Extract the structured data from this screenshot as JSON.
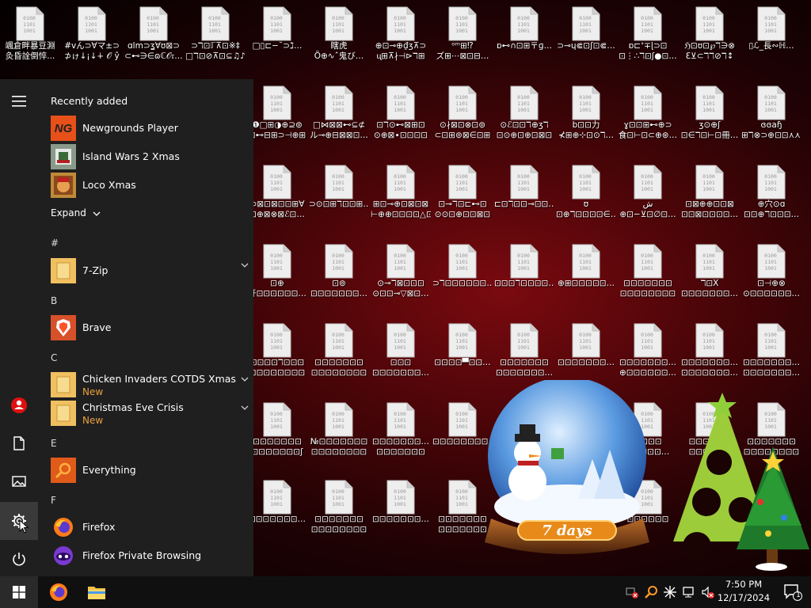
{
  "desktop": {
    "rows": [
      {
        "labels": [
          [
            "颯倉畔暴豆淵",
            "灸昏詮倒悴..."
          ],
          [
            "#vん⊃∀マ±⊃",
            "⊅ゖ↓¡↓∔ 𝒪 ŷ"
          ],
          [
            "ɑlm⊃ʓ∀ʊ⊠⊃",
            "⊂⊷∋∈ɷℂ𝒪𝔯…"
          ],
          [
            "⊃ℸ⊡ℾ⊼⊡※‡",
            "□ℸ⊡⊘⊼⊡⊆♫♪"
          ],
          [
            "□▯⊏−˘⊃ℷ…",
            ""
          ],
          [
            "瞎虎",
            "Ö⊕∿ˆ鬼び…"
          ],
          [
            "⊕⊡⊸⊕₫ʒ⊼⊃",
            "ᶙ⊞⊼∤⊣⊳ℸ⊞"
          ],
          [
            "ᵒᵐ⊞⁉",
            "ズ⊞⋯⊠⊡⊟…"
          ],
          [
            "ɒ⊷∩⊡⊞〒ɡ…",
            ""
          ],
          [
            "⊃⊸ɥ⋐⊡ʃ⊡⋐…",
            ""
          ],
          [
            "ɒ⊏ᐩ∓ɭ⊃⊡",
            "⊡⋮∴ℸ⊡ʃ●⊡…"
          ],
          [
            "ℌ⊡ʊ⊡℘ℸ∋⊗",
            "ℇ⊻⊂ℸℸ⊘ℸ↕"
          ],
          [
            "▯ℒ_長∾ℍ…",
            ""
          ]
        ]
      },
      {
        "labels": [
          [
            "❶□⊞◑⊕⊇⊚",
            "⊡⊷⊟⊞⊃⊣⊕⊞"
          ],
          [
            "□⋈⊠⊠⊷⊆⊄",
            "ル⊸⊕⊟⊠⊠⊡…"
          ],
          [
            "⊡ℸ⊙⊷⊠⊞⊡",
            "⊙⊕⊠∙⊡⊡⊡⊡"
          ],
          [
            "⊙∤⊠⊡⊗⊡⊚",
            "⊂⊡⊞⊚⊠∈⊡⊞"
          ],
          [
            "⊙ℰ⊡⊡ℸ⊕ʒℸ",
            "⊡⊙⊕⊡⊕⊡⊠⊡"
          ],
          [
            "b⊡⊡力",
            "⊀⊞⊕⊹⊡⊙ℸ…"
          ],
          [
            "ɣ⊡⊡⊞⊷⊕⊃",
            "食⊡⊢⊡⊂⊕⊛…"
          ],
          [
            "ʒ⊙⊕ʃ",
            "⊡∈ℸ⊡⊢⊡冊…"
          ],
          [
            "ɞɞaɧ",
            "⊞ℸ⊗⊃⊕⊡⊡⋏⋏…"
          ]
        ]
      },
      {
        "labels": [
          [
            "⊃⊠⊡⊠⊡⊡⊞∀",
            "⊡⊕⊠⊗⊠ℰ⊡…"
          ],
          [
            "⊃⊙⊡⊞ℸ⊡⊡⊞…",
            ""
          ],
          [
            "⊞⊡⊸⊕⊡⊠⊡⊠",
            "⊢⊕⊕⊡⊡⊡⊡△⊡"
          ],
          [
            "⊡⊸ℸ⊡⊏⊷⊡",
            "⊙⊙⊡⊕⊡⊡⊠⊡"
          ],
          [
            "⊏⊡ℸ⊡⊡⊸⊡⊡…",
            ""
          ],
          [
            "ʊ",
            "⊡⊕ℸ⊡⊡⊡⊡∈…"
          ],
          [
            "ش",
            "⊕⊡−⊻⊡∅⊡…"
          ],
          [
            "⊡⊠⊕⊕⊡⊡⊠",
            "⊡⊡⊠⊡⊡⊡⊡…"
          ],
          [
            "⊕穴⊙ɑ",
            "⊡⊡⊕ℸ⊡⊡⊡…"
          ]
        ]
      },
      {
        "labels": [
          [
            "⊡⊕",
            "牙⊡⊡⊡⊡⊡⊡…"
          ],
          [
            "⊡⊚",
            "⊡⊡⊡⊡⊡⊡⊡…"
          ],
          [
            "⊙⊸ℸ⊠⊡⊡⊡",
            "⊙⊡⊡⊸▽⊠⊡…"
          ],
          [
            "⊃ℸ⊡⊡⊡⊡⊡⊡…",
            ""
          ],
          [
            "⊡⊡⊡ℸ⊡⊡⊡⊡…",
            ""
          ],
          [
            "⊕⊞⊡⊡⊡⊡⊡…",
            ""
          ],
          [
            "⊡⊡⊡⊡⊡⊡⊡",
            "⊡⊡⊡⊡⊡⊡⊡⊡"
          ],
          [
            "ℸ⊡X",
            "⊡⊡⊡⊡⊡⊡⊡…"
          ],
          [
            "⊡⊣⊕⊗",
            "⊙⊡⊡⊡⊡⊡⊡…"
          ]
        ]
      },
      {
        "labels": [
          [
            "⊡⊡⊡⊡ℸ⊡⊡⊡",
            "⊡⊡⊡⊡⊡⊡⊡⊡"
          ],
          [
            "⊡⊡⊡⊡⊡⊡⊡",
            "⊡⊡⊡⊡⊡⊡⊡⊡"
          ],
          [
            "⊡⊡⊡",
            "⊡⊡⊡⊡⊡⊡⊡…"
          ],
          [
            "⊡⊡⊡⊡▀⊡⊡…",
            ""
          ],
          [
            "⊡⊡⊡⊡⊡⊡⊡",
            "⊡⊡⊡⊡⊡⊡⊡…"
          ],
          [
            "⊡⊡⊡⊡⊡⊡⊡…",
            ""
          ],
          [
            "⊡⊡⊡⊡⊡⊡⊡…",
            "⊕⊡⊡⊡⊡⊡⊡…"
          ],
          [
            "⊡⊡⊡⊡⊡⊡⊡…",
            "⊡⊡⊡⊡⊡⊡⊡…"
          ],
          [
            "⊡⊡⊡⊡⊡⊡⊡…",
            "⊡⊡⊡⊡⊡⊡⊡…"
          ]
        ]
      },
      {
        "labels": [
          [
            "⊡⊡⊡⊡⊡⊡⊡",
            "⊡⊡⊡⊡⊡⊡⊡ʃ"
          ],
          [
            "№⊡⊡⊡⊡⊡⊡⊡",
            "⊡⊡⊡⊡⊡⊡⊡⊡"
          ],
          [
            "⊡⊡⊡⊡⊡⊡⊡…",
            "⊡⊡⊡⊡⊡⊡⊡"
          ],
          [
            "⊡⊡⊡⊡⊡⊡⊡⊡…",
            ""
          ],
          [],
          [],
          [
            "⊡⊡⊡⊡",
            "⊡⊡⊡⊡⊡…"
          ],
          [
            "⊡⊡⊡⊡⊡⊡",
            "⊡⊡⊡⊡⊡⊡"
          ],
          [
            "⊡⊡⊡⊡⊡⊡⊡",
            "⊡⊡⊡⊡⊡⊡⊡⊡"
          ]
        ]
      },
      {
        "labels": [
          [
            "⊡⊡⊡⊡⊡⊡⊡…",
            ""
          ],
          [
            "⊡⊡⊡⊡⊡⊡⊡",
            "⊡⊡⊡⊡⊡⊡⊡⊡"
          ],
          [
            "⊡⊡⊡⊡⊡⊡⊡…",
            ""
          ],
          [
            "⊡⊡⊡⊡⊡⊡⊡",
            "⊡⊡⊡⊡⊡⊡⊡"
          ],
          [],
          [],
          [
            "⊡⊡⊡⊡⊡⊡",
            ""
          ]
        ]
      }
    ],
    "snow_globe_text": "7 days"
  },
  "start_menu": {
    "recently_added_title": "Recently added",
    "recent_apps": [
      "Newgrounds Player",
      "Island Wars 2 Xmas",
      "Loco Xmas"
    ],
    "expand_label": "Expand",
    "sections": [
      {
        "letter": "#",
        "apps": [
          {
            "name": "7-Zip",
            "sub": "",
            "expandable": true
          }
        ]
      },
      {
        "letter": "B",
        "apps": [
          {
            "name": "Brave",
            "sub": "",
            "expandable": false
          }
        ]
      },
      {
        "letter": "C",
        "apps": [
          {
            "name": "Chicken Invaders COTDS Xmas",
            "sub": "New",
            "expandable": true
          },
          {
            "name": "Christmas Eve Crisis",
            "sub": "New",
            "expandable": true
          }
        ]
      },
      {
        "letter": "E",
        "apps": [
          {
            "name": "Everything",
            "sub": "",
            "expandable": false
          }
        ]
      },
      {
        "letter": "F",
        "apps": [
          {
            "name": "Firefox",
            "sub": "",
            "expandable": false
          },
          {
            "name": "Firefox Private Browsing",
            "sub": "",
            "expandable": false
          }
        ]
      }
    ]
  },
  "taskbar": {
    "clock_time": "7:50 PM",
    "clock_date": "12/17/2024",
    "notification_count": "1"
  },
  "colors": {
    "accent": "#0078d4",
    "menu_bg": "#1f1f1f",
    "new_badge": "#e8a040",
    "folder_tile": "#f0c060"
  }
}
